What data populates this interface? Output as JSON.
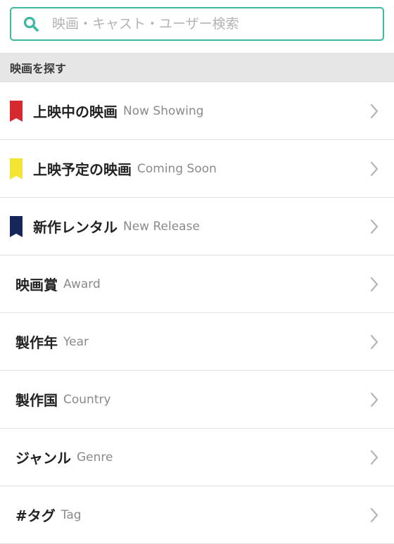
{
  "search": {
    "placeholder": "映画・キャスト・ユーザー検索",
    "accent_color": "#3fb8a1",
    "icon": "search-icon"
  },
  "section": {
    "title": "映画を探す"
  },
  "menu": {
    "items": [
      {
        "jp": "上映中の映画",
        "en": "Now Showing",
        "flag_color": "#d6282f",
        "icon": "chevron-right-icon"
      },
      {
        "jp": "上映予定の映画",
        "en": "Coming Soon",
        "flag_color": "#f4e535",
        "icon": "chevron-right-icon"
      },
      {
        "jp": "新作レンタル",
        "en": "New Release",
        "flag_color": "#15265a",
        "icon": "chevron-right-icon"
      },
      {
        "jp": "映画賞",
        "en": "Award",
        "icon": "chevron-right-icon"
      },
      {
        "jp": "製作年",
        "en": "Year",
        "icon": "chevron-right-icon"
      },
      {
        "jp": "製作国",
        "en": "Country",
        "icon": "chevron-right-icon"
      },
      {
        "jp": "ジャンル",
        "en": "Genre",
        "icon": "chevron-right-icon"
      },
      {
        "jp": "#タグ",
        "en": "Tag",
        "icon": "chevron-right-icon"
      }
    ]
  }
}
